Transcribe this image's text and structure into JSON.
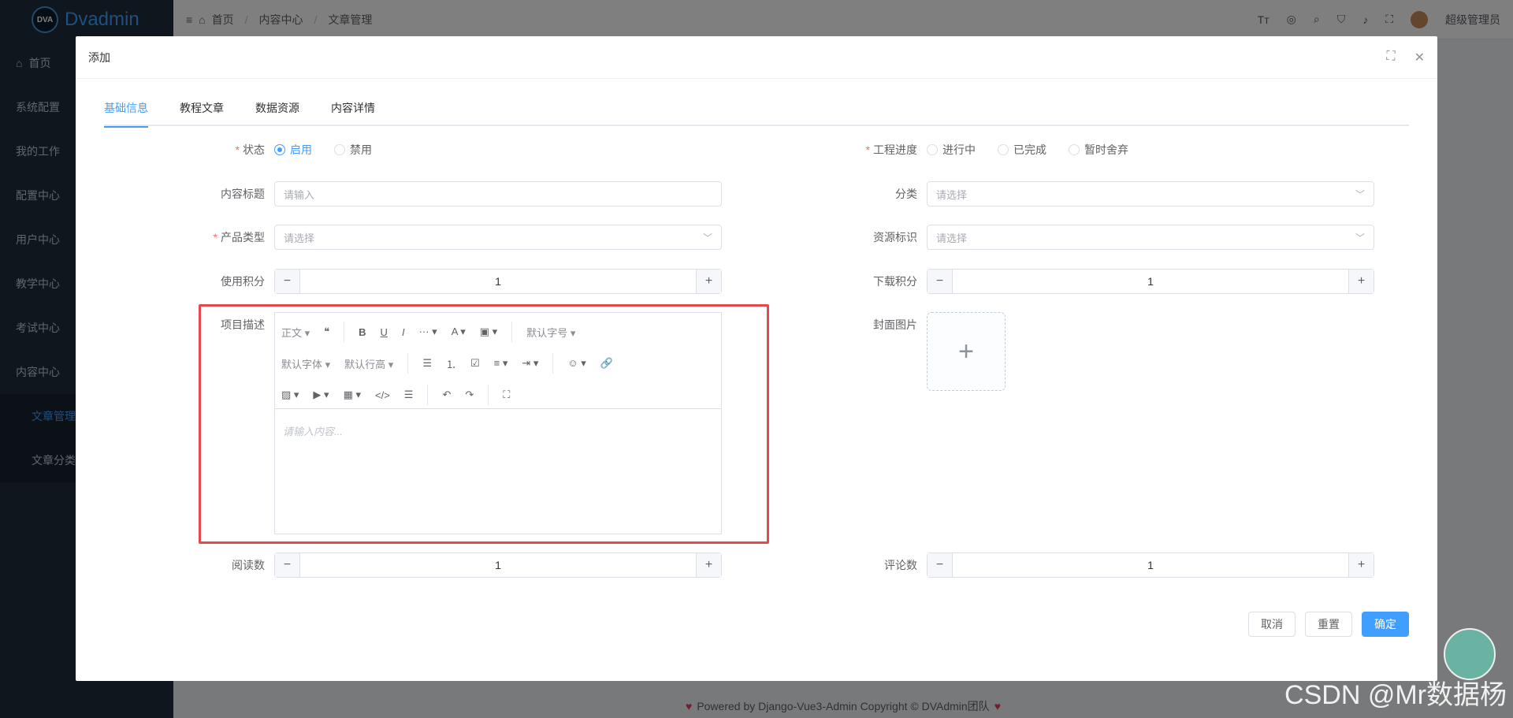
{
  "app": {
    "logo_text": "Dvadmin",
    "logo_badge": "DVA"
  },
  "sidebar": {
    "items": [
      {
        "label": "首页"
      },
      {
        "label": "系统配置"
      },
      {
        "label": "我的工作"
      },
      {
        "label": "配置中心"
      },
      {
        "label": "用户中心"
      },
      {
        "label": "教学中心"
      },
      {
        "label": "考试中心"
      },
      {
        "label": "内容中心"
      },
      {
        "label": "文章管理"
      },
      {
        "label": "文章分类"
      }
    ]
  },
  "breadcrumb": {
    "home": "首页",
    "level2": "内容中心",
    "level3": "文章管理",
    "sep": "/"
  },
  "user": {
    "name": "超级管理员"
  },
  "footer": {
    "text": "Powered by Django-Vue3-Admin Copyright © DVAdmin团队"
  },
  "watermark": "CSDN @Mr数据杨",
  "dialog": {
    "title": "添加",
    "tabs": [
      "基础信息",
      "教程文章",
      "数据资源",
      "内容详情"
    ],
    "form": {
      "status": {
        "label": "状态",
        "options": [
          "启用",
          "禁用"
        ],
        "selected": "启用"
      },
      "progress": {
        "label": "工程进度",
        "options": [
          "进行中",
          "已完成",
          "暂时舍弃"
        ]
      },
      "title": {
        "label": "内容标题",
        "placeholder": "请输入"
      },
      "category": {
        "label": "分类",
        "placeholder": "请选择"
      },
      "product_type": {
        "label": "产品类型",
        "placeholder": "请选择"
      },
      "resource_id": {
        "label": "资源标识",
        "placeholder": "请选择"
      },
      "use_points": {
        "label": "使用积分",
        "value": "1"
      },
      "download_points": {
        "label": "下载积分",
        "value": "1"
      },
      "description": {
        "label": "项目描述",
        "placeholder": "请输入内容...",
        "toolbar": {
          "paragraph": "正文",
          "font_size": "默认字号",
          "font_family": "默认字体",
          "line_height": "默认行高"
        }
      },
      "cover": {
        "label": "封面图片"
      },
      "reads": {
        "label": "阅读数",
        "value": "1"
      },
      "comments": {
        "label": "评论数",
        "value": "1"
      }
    },
    "buttons": {
      "cancel": "取消",
      "reset": "重置",
      "confirm": "确定"
    }
  }
}
